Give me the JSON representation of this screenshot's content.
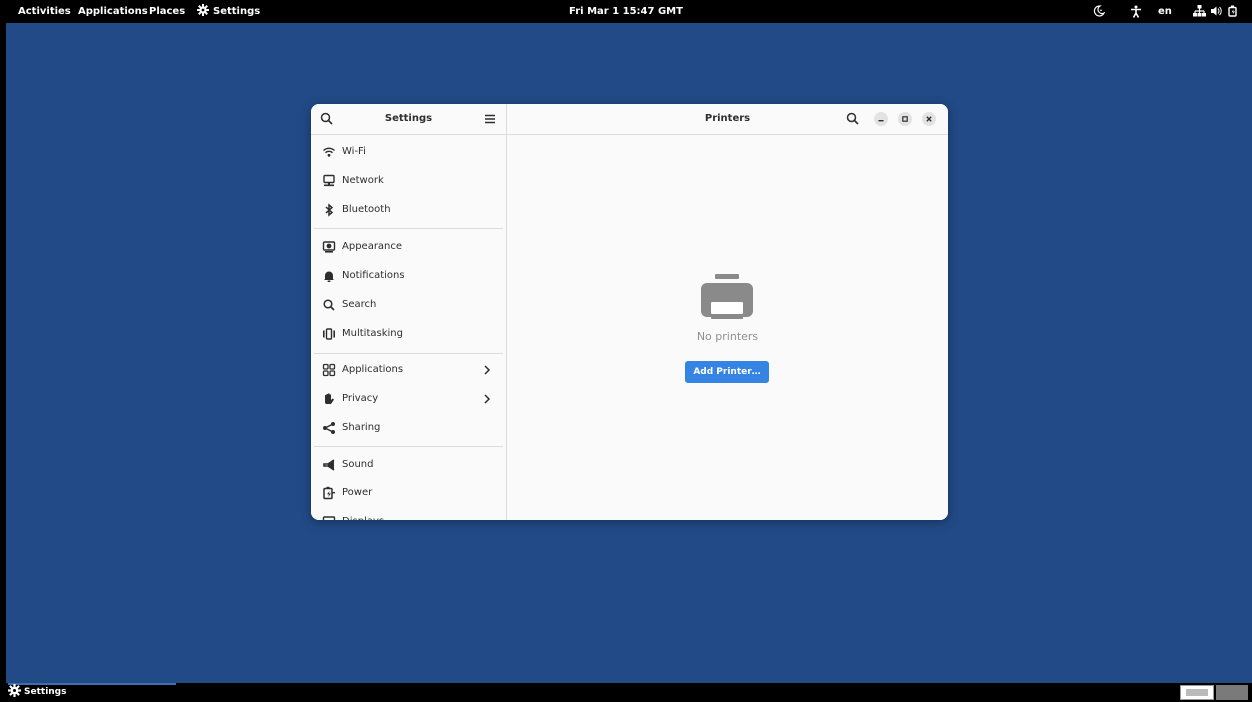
{
  "topbar": {
    "activities": "Activities",
    "applications": "Applications",
    "places": "Places",
    "app_menu": "Settings",
    "clock": "Fri Mar 1  15:47 GMT",
    "language": "en"
  },
  "window": {
    "sidebar_title": "Settings",
    "content_title": "Printers",
    "sidebar_items": [
      {
        "label": "Wi-Fi",
        "icon": "wifi-icon"
      },
      {
        "label": "Network",
        "icon": "network-icon"
      },
      {
        "label": "Bluetooth",
        "icon": "bluetooth-icon"
      },
      {
        "label": "Appearance",
        "icon": "appearance-icon"
      },
      {
        "label": "Notifications",
        "icon": "bell-icon"
      },
      {
        "label": "Search",
        "icon": "search-icon"
      },
      {
        "label": "Multitasking",
        "icon": "multitasking-icon"
      },
      {
        "label": "Applications",
        "icon": "apps-grid-icon"
      },
      {
        "label": "Privacy",
        "icon": "hand-icon"
      },
      {
        "label": "Sharing",
        "icon": "share-icon"
      },
      {
        "label": "Sound",
        "icon": "speaker-icon"
      },
      {
        "label": "Power",
        "icon": "power-icon"
      },
      {
        "label": "Displays",
        "icon": "display-icon"
      }
    ],
    "empty_state": {
      "message": "No printers",
      "button": "Add Printer…"
    }
  },
  "bottombar": {
    "task_label": "Settings"
  },
  "colors": {
    "desktop": "#214a86",
    "accent": "#3584e4",
    "panel": "#000000"
  }
}
